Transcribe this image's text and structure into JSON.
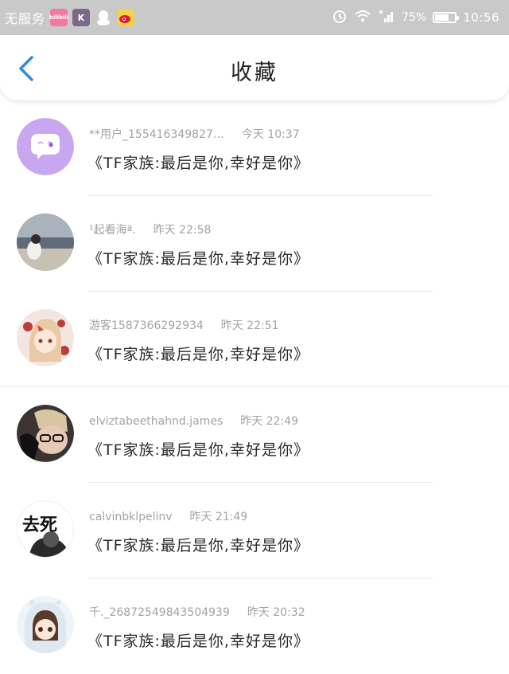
{
  "status_bar": {
    "carrier": "无服务",
    "bili_label": "bilibili",
    "k_label": "K",
    "battery_percent": "75%",
    "battery_level": 0.75,
    "time": "10:56"
  },
  "header": {
    "title": "收藏"
  },
  "items": [
    {
      "user": "**用户_155416349827…",
      "time": "今天 10:37",
      "content": "《TF家族:最后是你,幸好是你》",
      "avatar_text": ""
    },
    {
      "user": "¹起看海ª.",
      "time": "昨天 22:58",
      "content": "《TF家族:最后是你,幸好是你》",
      "avatar_text": ""
    },
    {
      "user": "游客1587366292934",
      "time": "昨天 22:51",
      "content": "《TF家族:最后是你,幸好是你》",
      "avatar_text": ""
    },
    {
      "user": "elviztabeethahnd.james",
      "time": "昨天 22:49",
      "content": "《TF家族:最后是你,幸好是你》",
      "avatar_text": ""
    },
    {
      "user": "calvinbklpelinv",
      "time": "昨天 21:49",
      "content": "《TF家族:最后是你,幸好是你》",
      "avatar_text": "去死"
    },
    {
      "user": "千._2687254984350493​9",
      "time": "昨天 20:32",
      "content": "《TF家族:最后是你,幸好是你》",
      "avatar_text": ""
    }
  ],
  "colors": {
    "status_bar_bg": "#c9c9c9",
    "back_arrow": "#2e8ae6",
    "meta_text": "#a3a3a3"
  }
}
